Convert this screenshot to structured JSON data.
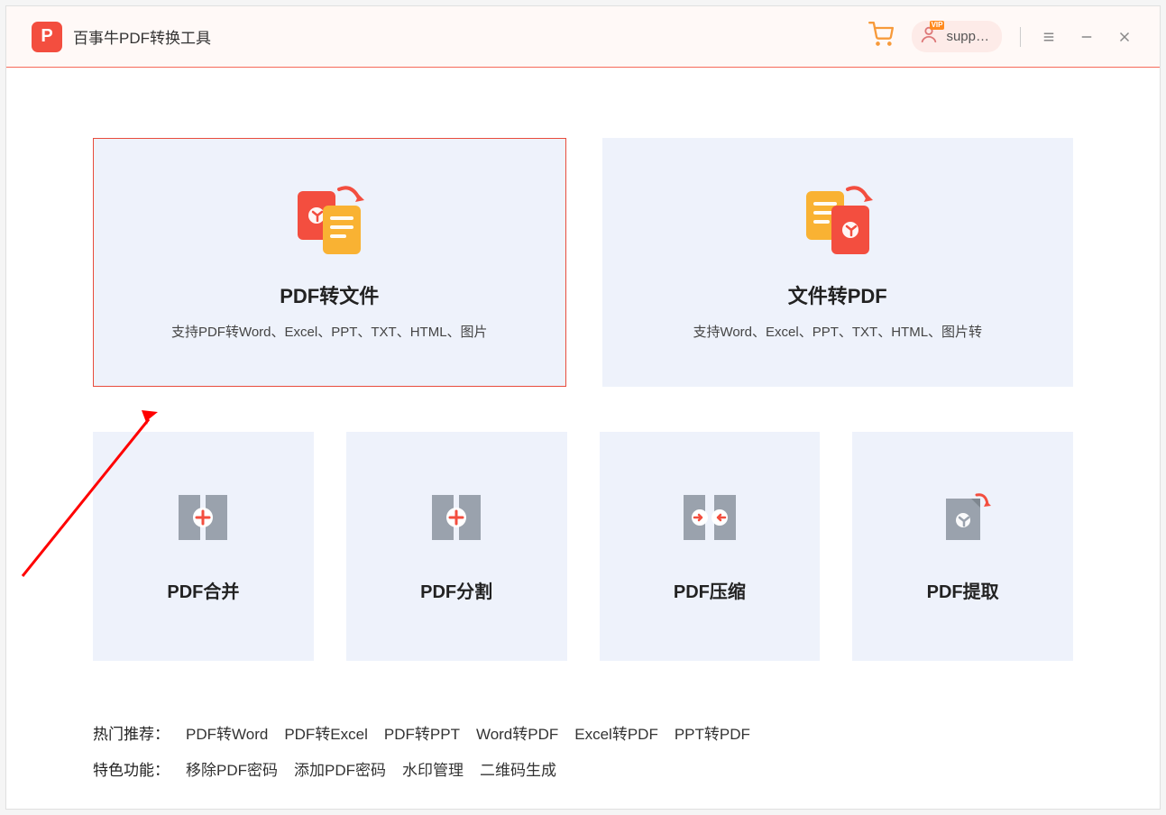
{
  "app": {
    "title": "百事牛PDF转换工具",
    "user_label": "supp…",
    "vip_badge": "VIP"
  },
  "big_cards": {
    "pdf_to_file": {
      "title": "PDF转文件",
      "sub": "支持PDF转Word、Excel、PPT、TXT、HTML、图片"
    },
    "file_to_pdf": {
      "title": "文件转PDF",
      "sub": "支持Word、Excel、PPT、TXT、HTML、图片转"
    }
  },
  "small_cards": {
    "merge": {
      "title": "PDF合并"
    },
    "split": {
      "title": "PDF分割"
    },
    "compress": {
      "title": "PDF压缩"
    },
    "extract": {
      "title": "PDF提取"
    }
  },
  "footer": {
    "hot_label": "热门推荐：",
    "hot_links": [
      "PDF转Word",
      "PDF转Excel",
      "PDF转PPT",
      "Word转PDF",
      "Excel转PDF",
      "PPT转PDF"
    ],
    "feat_label": "特色功能：",
    "feat_links": [
      "移除PDF密码",
      "添加PDF密码",
      "水印管理",
      "二维码生成"
    ]
  },
  "colors": {
    "accent": "#f34e3f",
    "card_bg": "#eef2fb"
  }
}
